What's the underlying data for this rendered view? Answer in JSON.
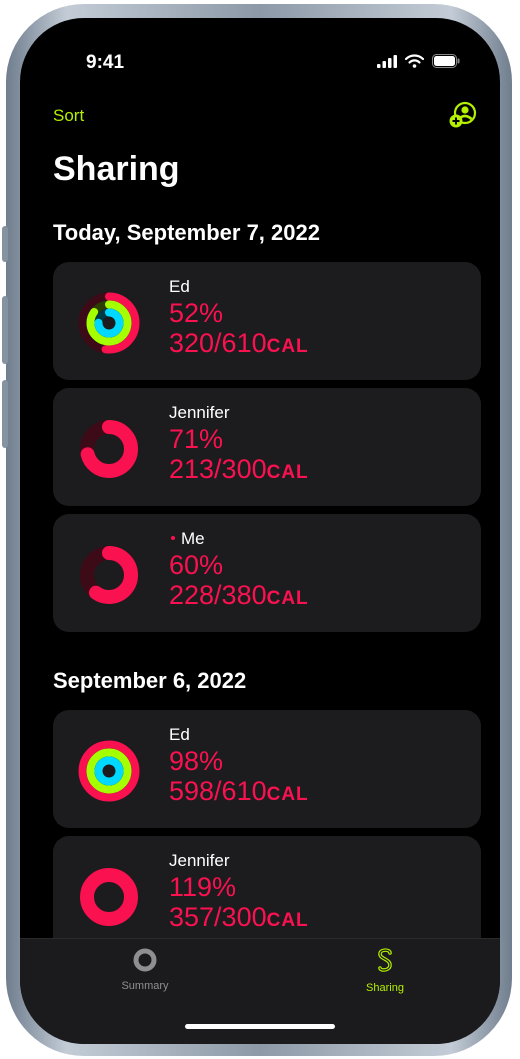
{
  "status": {
    "time": "9:41"
  },
  "nav": {
    "sort_label": "Sort"
  },
  "page": {
    "title": "Sharing"
  },
  "sections": [
    {
      "header": "Today, September 7, 2022",
      "entries": [
        {
          "name": "Ed",
          "percent": "52%",
          "calories": "320/610",
          "unit": "CAL",
          "move_fraction": 0.52,
          "exercise_fraction": 0.85,
          "stand_fraction": 0.75
        },
        {
          "name": "Jennifer",
          "percent": "71%",
          "calories": "213/300",
          "unit": "CAL",
          "move_fraction": 0.71
        },
        {
          "name": "Me",
          "percent": "60%",
          "calories": "228/380",
          "unit": "CAL",
          "move_fraction": 0.6
        }
      ]
    },
    {
      "header": "September 6, 2022",
      "entries": [
        {
          "name": "Ed",
          "percent": "98%",
          "calories": "598/610",
          "unit": "CAL",
          "move_fraction": 0.98,
          "exercise_fraction": 1.0,
          "stand_fraction": 1.0
        },
        {
          "name": "Jennifer",
          "percent": "119%",
          "calories": "357/300",
          "unit": "CAL",
          "move_fraction": 1.0
        }
      ]
    }
  ],
  "tabs": [
    {
      "label": "Summary",
      "icon": "summary-ring-icon",
      "active": false
    },
    {
      "label": "Sharing",
      "icon": "sharing-icon",
      "active": true
    }
  ],
  "colors": {
    "accent": "#b4f000",
    "move": "#fa1150",
    "exercise": "#a6ff00",
    "stand": "#00d8ff",
    "card": "#1c1c1e"
  }
}
